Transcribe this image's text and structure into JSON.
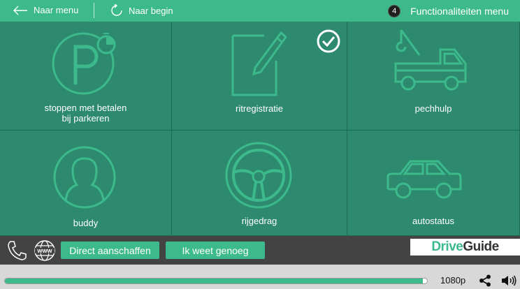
{
  "topbar": {
    "back_label": "Naar menu",
    "restart_label": "Naar begin",
    "menu_count": "4",
    "menu_label": "Functionaliteiten menu"
  },
  "tiles": [
    {
      "label_line1": "stoppen met betalen",
      "label_line2": "bij parkeren",
      "icon": "parking-timer-icon"
    },
    {
      "label_line1": "ritregistratie",
      "label_line2": "",
      "icon": "notepad-pencil-icon",
      "checked": true
    },
    {
      "label_line1": "pechhulp",
      "label_line2": "",
      "icon": "tow-truck-icon"
    },
    {
      "label_line1": "buddy",
      "label_line2": "",
      "icon": "person-avatar-icon"
    },
    {
      "label_line1": "rijgedrag",
      "label_line2": "",
      "icon": "steering-wheel-icon"
    },
    {
      "label_line1": "autostatus",
      "label_line2": "",
      "icon": "car-icon"
    }
  ],
  "actionbar": {
    "buy_label": "Direct aanschaffen",
    "enough_label": "Ik weet genoeg",
    "logo_drive": "Drive",
    "logo_guide": "Guide"
  },
  "video": {
    "progress": 0.99,
    "quality": "1080p"
  },
  "colors": {
    "accent": "#3dba8c",
    "tile_bg": "#2d8a6e",
    "bar_dark": "#434343"
  }
}
